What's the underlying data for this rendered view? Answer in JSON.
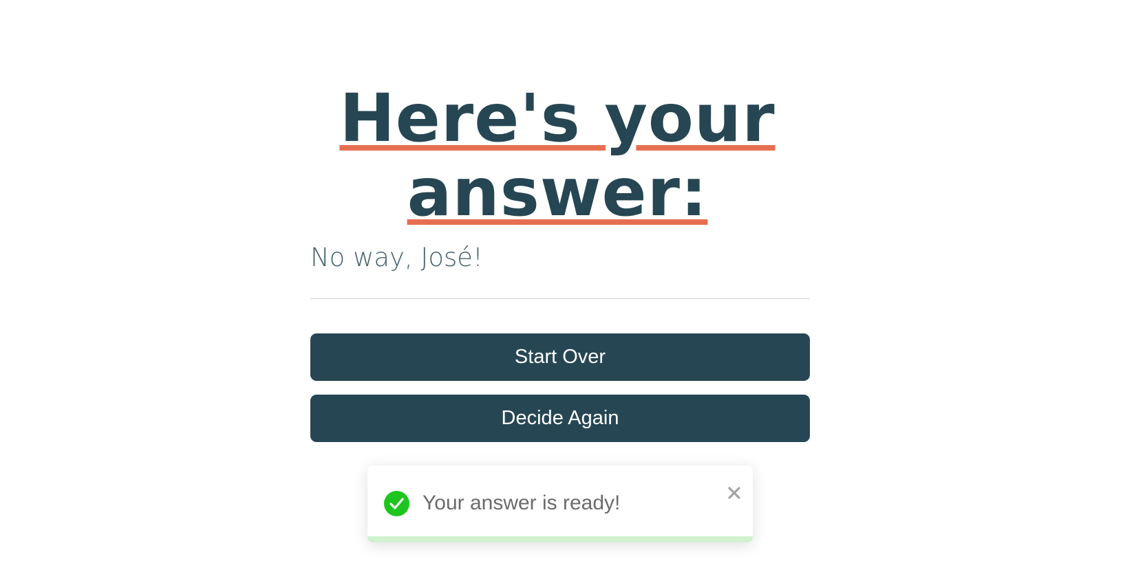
{
  "heading": {
    "line1": "Here's your",
    "line2": "answer:"
  },
  "answer_text": "No way, José!",
  "buttons": {
    "start_over": "Start Over",
    "decide_again": "Decide Again"
  },
  "toast": {
    "message": "Your answer is ready!",
    "icon": "check-circle-icon",
    "close_icon": "close-icon",
    "progress": 1.0
  },
  "colors": {
    "primary": "#264653",
    "accent": "#e76f51",
    "success": "#1ec51e",
    "progress": "#d0f2cf"
  }
}
